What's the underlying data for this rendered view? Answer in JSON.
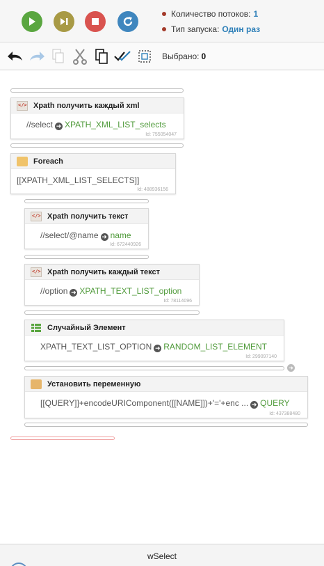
{
  "run_info": {
    "threads_label": "Количество потоков:",
    "threads_value": "1",
    "launch_label": "Тип запуска:",
    "launch_value": "Один раз"
  },
  "toolbar": {
    "selected_label": "Выбрано:",
    "selected_value": "0"
  },
  "blocks": [
    {
      "title": "Xpath получить каждый xml",
      "input": "//select",
      "output": "XPATH_XML_LIST_selects",
      "id": "Id: 755054047"
    },
    {
      "title": "Foreach",
      "input": "[[XPATH_XML_LIST_SELECTS]]",
      "output": "",
      "id": "Id: 488936156"
    },
    {
      "title": "Xpath получить текст",
      "input": "//select/@name",
      "output": "name",
      "id": "Id: 672440926"
    },
    {
      "title": "Xpath получить каждый текст",
      "input": "//option",
      "output": "XPATH_TEXT_LIST_option",
      "id": "Id: 78114096"
    },
    {
      "title": "Случайный Элемент",
      "input": "XPATH_TEXT_LIST_OPTION",
      "output": "RANDOM_LIST_ELEMENT",
      "id": "Id: 299097140"
    },
    {
      "title": "Установить переменную",
      "input": "[[QUERY]]+encodeURIComponent([[NAME]])+'='+enc ...",
      "output": "QUERY",
      "id": "Id: 437388480"
    }
  ],
  "status": {
    "project_name": "wSelect"
  }
}
